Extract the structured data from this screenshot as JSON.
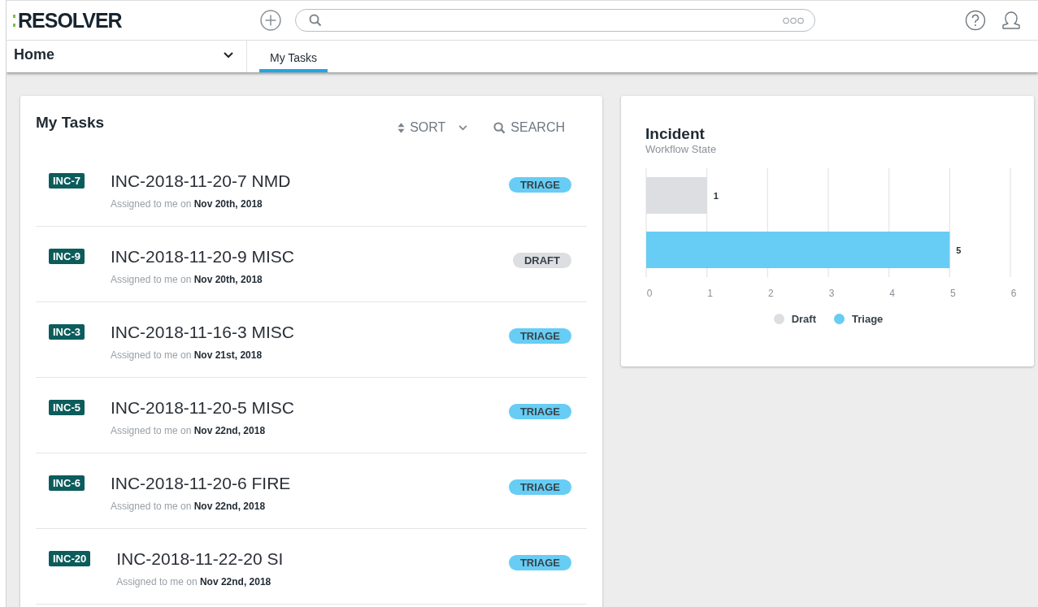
{
  "header": {
    "logo": "RESOLVER"
  },
  "nav": {
    "workspace": "Home",
    "tabs": [
      {
        "label": "My Tasks",
        "selected": true
      }
    ]
  },
  "tasks_card": {
    "title": "My Tasks",
    "sort": "SORT",
    "search": "SEARCH",
    "tasks": [
      {
        "id": "INC-7",
        "name": "INC-2018-11-20-7 NMD",
        "assigned": "Assigned to me on",
        "date": "Nov 20th, 2018",
        "status": "TRIAGE",
        "color": "#67cdf4"
      },
      {
        "id": "INC-9",
        "name": "INC-2018-11-20-9 MISC",
        "assigned": "Assigned to me on",
        "date": "Nov 20th, 2018",
        "status": "DRAFT",
        "color": "#dcdee1"
      },
      {
        "id": "INC-3",
        "name": "INC-2018-11-16-3 MISC",
        "assigned": "Assigned to me on",
        "date": "Nov 21st, 2018",
        "status": "TRIAGE",
        "color": "#67cdf4"
      },
      {
        "id": "INC-5",
        "name": "INC-2018-11-20-5 MISC",
        "assigned": "Assigned to me on",
        "date": "Nov 22nd, 2018",
        "status": "TRIAGE",
        "color": "#67cdf4"
      },
      {
        "id": "INC-6",
        "name": "INC-2018-11-20-6 FIRE",
        "assigned": "Assigned to me on",
        "date": "Nov 22nd, 2018",
        "status": "TRIAGE",
        "color": "#67cdf4"
      },
      {
        "id": "INC-20",
        "name": "INC-2018-11-22-20 SI",
        "assigned": "Assigned to me on",
        "date": "Nov 22nd, 2018",
        "status": "TRIAGE",
        "color": "#67cdf4"
      }
    ]
  },
  "chart_card": {
    "title": "Incident",
    "subtitle": "Workflow State",
    "chart_data": {
      "type": "bar",
      "orientation": "horizontal",
      "grid": true,
      "legend": true,
      "series": [
        {
          "name": "Draft",
          "color": "#dcdee1",
          "values": [
            1,
            null
          ]
        },
        {
          "name": "Triage",
          "color": "#67cdf4",
          "values": [
            null,
            5
          ]
        }
      ],
      "xlim": [
        0,
        6
      ],
      "xticks": [
        0,
        1,
        2,
        3,
        4,
        5,
        6
      ],
      "data_labels": true
    }
  }
}
